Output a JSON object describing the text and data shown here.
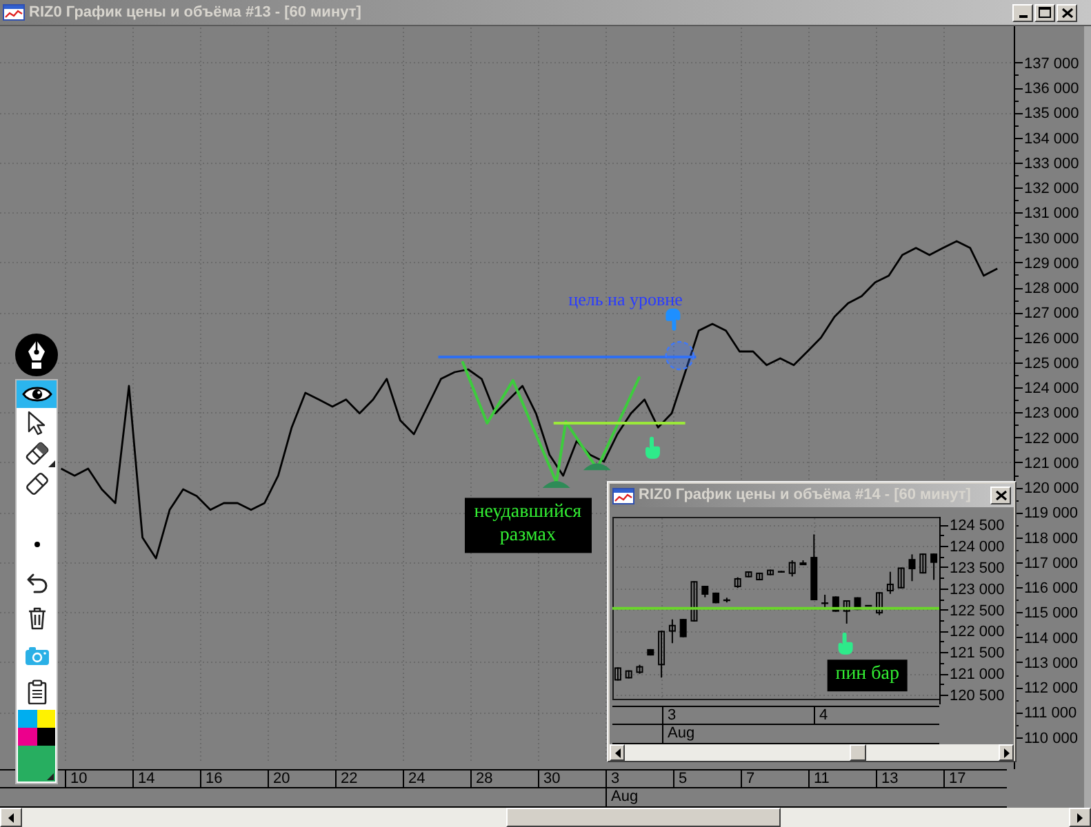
{
  "window": {
    "title": "RIZ0 График цены и объёма #13 - [60 минут]"
  },
  "toolbar": {
    "tools": [
      {
        "selected": true,
        "menu": false
      },
      {
        "selected": false,
        "menu": false
      },
      {
        "selected": false,
        "menu": true
      },
      {
        "selected": false,
        "menu": false
      },
      {
        "selected": false,
        "menu": false
      },
      {
        "selected": false,
        "menu": false
      },
      {
        "selected": false,
        "menu": false
      },
      {
        "selected": false,
        "menu": false
      },
      {
        "selected": false,
        "menu": false
      }
    ],
    "palette": [
      {
        "color": "#00aeef"
      },
      {
        "color": "#fff200"
      },
      {
        "color": "#ec008c"
      },
      {
        "color": "#000000"
      }
    ],
    "current_color": {
      "color": "#27ae60"
    }
  },
  "main_chart": {
    "chart_data": {
      "type": "line",
      "grid": true,
      "ylim": [
        109000,
        138400
      ],
      "yticks": [
        {
          "value": 137000,
          "label": "137 000"
        },
        {
          "value": 136000,
          "label": "136 000"
        },
        {
          "value": 135000,
          "label": "135 000"
        },
        {
          "value": 134000,
          "label": "134 000"
        },
        {
          "value": 133000,
          "label": "133 000"
        },
        {
          "value": 132000,
          "label": "132 000"
        },
        {
          "value": 131000,
          "label": "131 000"
        },
        {
          "value": 130000,
          "label": "130 000"
        },
        {
          "value": 129000,
          "label": "129 000"
        },
        {
          "value": 128000,
          "label": "128 000"
        },
        {
          "value": 127000,
          "label": "127 000"
        },
        {
          "value": 126000,
          "label": "126 000"
        },
        {
          "value": 125000,
          "label": "125 000"
        },
        {
          "value": 124000,
          "label": "124 000"
        },
        {
          "value": 123000,
          "label": "123 000"
        },
        {
          "value": 122000,
          "label": "122 000"
        },
        {
          "value": 121000,
          "label": "121 000"
        },
        {
          "value": 120000,
          "label": "120 000"
        },
        {
          "value": 119000,
          "label": "119 000"
        },
        {
          "value": 118000,
          "label": "118 000"
        },
        {
          "value": 117000,
          "label": "117 000"
        },
        {
          "value": 116000,
          "label": "116 000"
        },
        {
          "value": 115000,
          "label": "115 000"
        },
        {
          "value": 114000,
          "label": "114 000"
        },
        {
          "value": 113000,
          "label": "113 000"
        },
        {
          "value": 112000,
          "label": "112 000"
        },
        {
          "value": 111000,
          "label": "111 000"
        },
        {
          "value": 110000,
          "label": "110 000"
        }
      ],
      "series": [
        {
          "color": "#000000",
          "values": [
            null,
            null,
            null,
            null,
            120750,
            120470,
            120750,
            119920,
            119370,
            124060,
            117990,
            117160,
            119100,
            119920,
            119650,
            119100,
            119370,
            119370,
            119100,
            119370,
            120470,
            122400,
            123780,
            123510,
            123230,
            123510,
            122960,
            123510,
            124340,
            122680,
            122130,
            123230,
            124340,
            124610,
            124720,
            124340,
            122960,
            123510,
            124060,
            122960,
            121300,
            120470,
            121850,
            121300,
            121030,
            122130,
            122960,
            123510,
            122400,
            122960,
            124610,
            126270,
            126540,
            126270,
            125440,
            125440,
            124890,
            125160,
            124890,
            125440,
            125990,
            126820,
            127370,
            127650,
            128200,
            128470,
            129300,
            129580,
            129300,
            129580,
            129850,
            129580,
            128470,
            128750
          ]
        }
      ]
    },
    "date_axis": {
      "days": [
        {
          "label": "10"
        },
        {
          "label": "14"
        },
        {
          "label": "16"
        },
        {
          "label": "20"
        },
        {
          "label": "22"
        },
        {
          "label": "24"
        },
        {
          "label": "28"
        },
        {
          "label": "30"
        },
        {
          "label": "3",
          "month": "Aug"
        },
        {
          "label": "5"
        },
        {
          "label": "7"
        },
        {
          "label": "11"
        },
        {
          "label": "13"
        },
        {
          "label": "17"
        }
      ]
    },
    "notes": [
      {
        "kind": "caption",
        "text": "цель на уровне"
      },
      {
        "kind": "box",
        "text": "неудавшийся размах"
      }
    ]
  },
  "inset_window": {
    "title": "RIZ0 График цены и объёма #14 - [60 минут]",
    "chart_data": {
      "type": "candlestick",
      "grid": true,
      "ylim": [
        120400,
        124650
      ],
      "yticks": [
        {
          "value": 124500,
          "label": "124 500"
        },
        {
          "value": 124000,
          "label": "124 000"
        },
        {
          "value": 123500,
          "label": "123 500"
        },
        {
          "value": 123000,
          "label": "123 000"
        },
        {
          "value": 122500,
          "label": "122 500"
        },
        {
          "value": 122000,
          "label": "122 000"
        },
        {
          "value": 121500,
          "label": "121 500"
        },
        {
          "value": 121000,
          "label": "121 000"
        },
        {
          "value": 120500,
          "label": "120 500"
        }
      ],
      "ohlc": [
        [
          120830,
          121140,
          120830,
          121140
        ],
        [
          120880,
          121070,
          120880,
          121070
        ],
        [
          121010,
          121200,
          120990,
          121170
        ],
        [
          121570,
          121570,
          121420,
          121420
        ],
        [
          121190,
          122000,
          120900,
          122000
        ],
        [
          121980,
          122270,
          121710,
          122140
        ],
        [
          122280,
          122280,
          121850,
          121850
        ],
        [
          122220,
          123170,
          122220,
          123170
        ],
        [
          123060,
          123060,
          122790,
          122850
        ],
        [
          122900,
          122900,
          122650,
          122650
        ],
        [
          122740,
          122780,
          122670,
          122700
        ],
        [
          123030,
          123260,
          123010,
          123240
        ],
        [
          123260,
          123400,
          123260,
          123400
        ],
        [
          123190,
          123370,
          123190,
          123370
        ],
        [
          123310,
          123440,
          123310,
          123440
        ],
        [
          123410,
          123410,
          123370,
          123370
        ],
        [
          123340,
          123660,
          123280,
          123620
        ],
        [
          123600,
          123660,
          123550,
          123610
        ],
        [
          123740,
          124270,
          122720,
          122720
        ],
        [
          122650,
          122850,
          122560,
          122650
        ],
        [
          122810,
          122810,
          122450,
          122450
        ],
        [
          122450,
          122720,
          122170,
          122720
        ],
        [
          122790,
          122790,
          122490,
          122490
        ],
        [
          122590,
          122600,
          122580,
          122590
        ],
        [
          122410,
          122910,
          122370,
          122910
        ],
        [
          122930,
          123390,
          122870,
          123110
        ],
        [
          123000,
          123490,
          123000,
          123490
        ],
        [
          123690,
          123800,
          123170,
          123450
        ],
        [
          123350,
          123820,
          123350,
          123820
        ],
        [
          123820,
          123820,
          123200,
          123600
        ]
      ]
    },
    "date_axis": {
      "days": [
        {
          "label": "3",
          "month": "Aug"
        },
        {
          "label": "4"
        }
      ]
    },
    "notes": [
      {
        "kind": "box",
        "text": "пин бар"
      }
    ]
  }
}
